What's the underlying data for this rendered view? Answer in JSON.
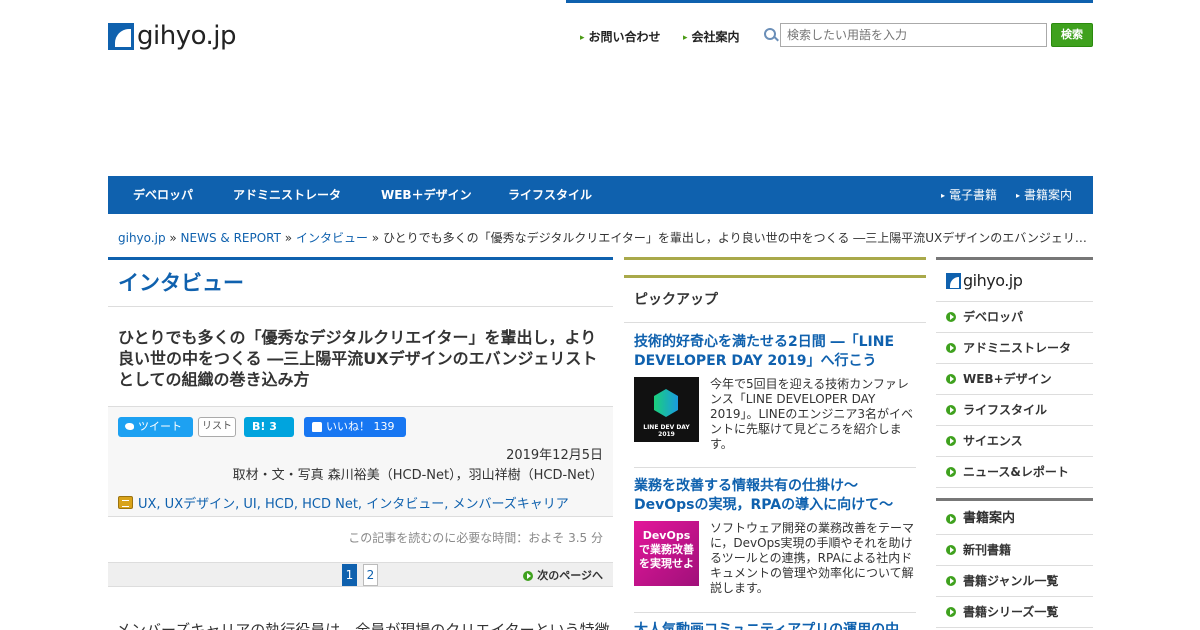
{
  "header": {
    "logo_text": "gihyo.jp",
    "links": [
      "お問い合わせ",
      "会社案内"
    ],
    "search_placeholder": "検索したい用語を入力",
    "search_button": "検索"
  },
  "gnav": {
    "items": [
      "デベロッパ",
      "アドミニストレータ",
      "WEB＋デザイン",
      "ライフスタイル"
    ],
    "sub": [
      "電子書籍",
      "書籍案内"
    ]
  },
  "breadcrumb": {
    "links": [
      "gihyo.jp",
      "NEWS & REPORT",
      "インタビュー"
    ],
    "sep": " » ",
    "current": "ひとりでも多くの「優秀なデジタルクリエイター」を輩出し，より良い世の中をつくる ―三上陽平流UXデザインのエバンジェリ…"
  },
  "main": {
    "section_title": "インタビュー",
    "article_title": "ひとりでも多くの「優秀なデジタルクリエイター」を輩出し，より良い世の中をつくる ―三上陽平流UXデザインのエバンジェリストとしての組織の巻き込み方",
    "share": {
      "tweet": "ツイート",
      "list": "リスト",
      "hatebu": "B! 3",
      "like": "いいね！ 139"
    },
    "date": "2019年12月5日",
    "author": "取材・文・写真 森川裕美（HCD-Net），羽山祥樹（HCD-Net）",
    "tags": "UX, UXデザイン, UI, HCD, HCD Net, インタビュー, メンバーズキャリア",
    "read_time": "この記事を読むのに必要な時間：およそ 3.5 分",
    "pager": {
      "current": "1",
      "next_num": "2",
      "next_label": "次のページへ"
    },
    "body_start": "メンバーズキャリアの執行役員は，全員が現場のクリエイターという特徴"
  },
  "pickup": {
    "title": "ピックアップ",
    "items": [
      {
        "headline": "技術的好奇心を満たせる2日間 ―「LINE DEVELOPER DAY 2019」へ行こう",
        "thumb_text": "LINE DEV DAY 2019",
        "desc": "今年で5回目を迎える技術カンファレンス「LINE DEVELOPER DAY 2019」。LINEのエンジニア3名がイベントに先駆けて見どころを紹介します。"
      },
      {
        "headline": "業務を改善する情報共有の仕掛け～DevOpsの実現，RPAの導入に向けて～",
        "thumb_text": "DevOpsで業務改善を実現せよ",
        "desc": "ソフトウェア開発の業務改善をテーマに，DevOps実現の手順やそれを助けるツールとの連携，RPAによる社内ドキュメントの管理や効率化について解説します。"
      },
      {
        "headline": "大人気動画コミュニティアプリの運用の中"
      }
    ]
  },
  "sidebar": {
    "logo_text": "gihyo.jp",
    "items": [
      "デベロッパ",
      "アドミニストレータ",
      "WEB+デザイン",
      "ライフスタイル",
      "サイエンス",
      "ニュース&レポート"
    ],
    "books_head": "書籍案内",
    "books": [
      "新刊書籍",
      "書籍ジャンル一覧",
      "書籍シリーズ一覧"
    ]
  }
}
